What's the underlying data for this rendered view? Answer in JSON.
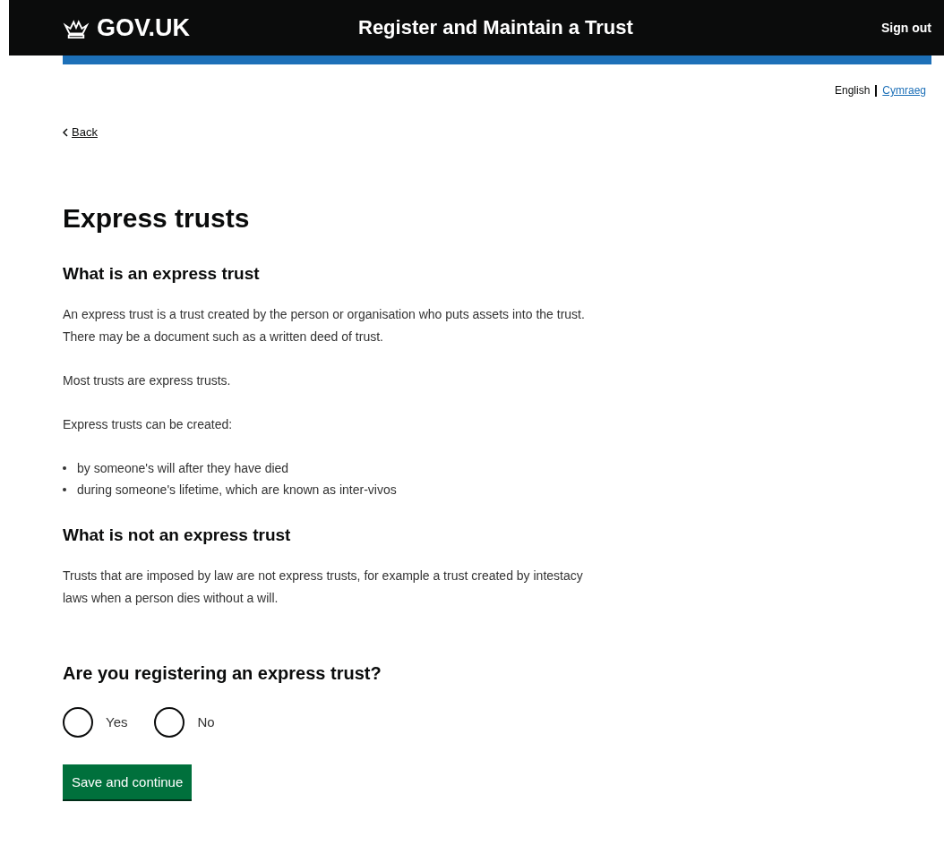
{
  "header": {
    "logo": "GOV.UK",
    "service": "Register and Maintain a Trust",
    "sign_out": "Sign out"
  },
  "languages": [
    {
      "label": "English",
      "selected": true
    },
    {
      "label": "Cymraeg",
      "selected": false
    }
  ],
  "back_link": "Back",
  "title": "Express trusts",
  "sections": [
    {
      "heading": "What is an express trust",
      "paragraphs": [
        "An express trust is a trust created by the person or organisation who puts assets into the trust. There may be a document such as a written deed of trust.",
        "Most trusts are express trusts.",
        "Express trusts can be created:"
      ],
      "bullets": [
        "by someone's will after they have died",
        "during someone's lifetime, which are known as inter-vivos"
      ]
    },
    {
      "heading": "What is not an express trust",
      "paragraphs": [
        "Trusts that are imposed by law are not express trusts, for example a trust created by intestacy laws when a person dies without a will."
      ]
    }
  ],
  "question": {
    "legend": "Are you registering an express trust?",
    "options": [
      {
        "label": "Yes",
        "selected": false
      },
      {
        "label": "No",
        "selected": false
      }
    ]
  },
  "button": "Save and continue"
}
